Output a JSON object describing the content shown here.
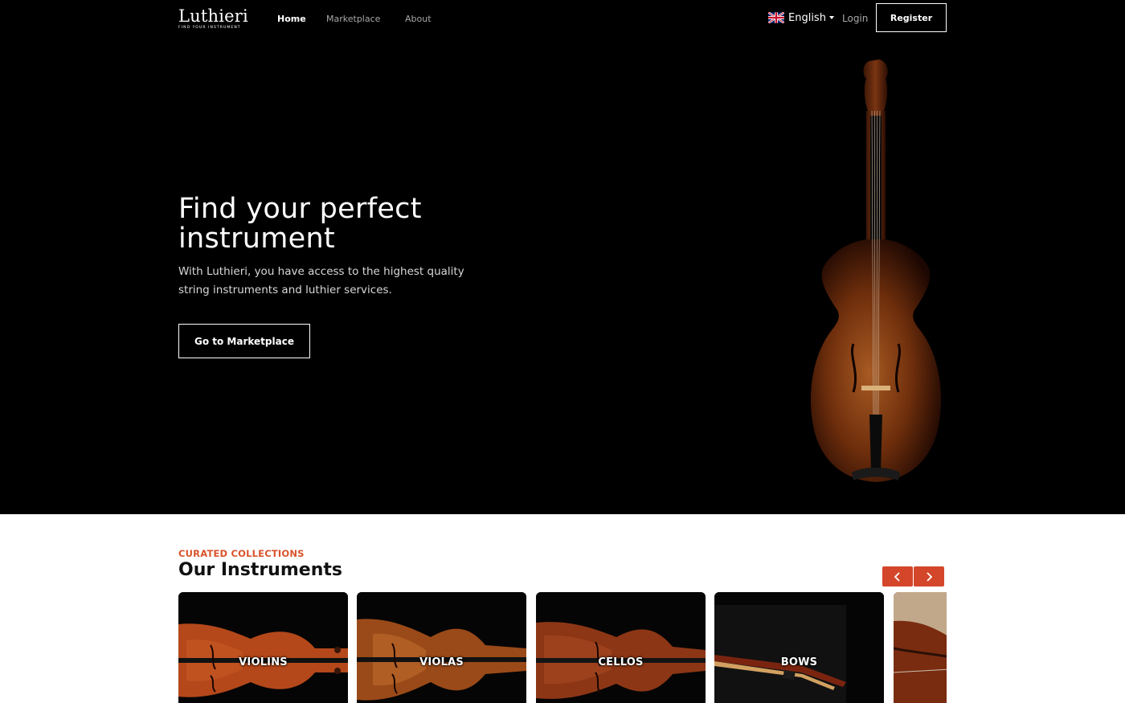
{
  "header": {
    "logo": {
      "wordmark": "Luthieri",
      "tagline": "FIND YOUR INSTRUMENT"
    },
    "nav": [
      {
        "label": "Home",
        "active": true
      },
      {
        "label": "Marketplace",
        "active": false
      },
      {
        "label": "About",
        "active": false
      }
    ],
    "language": {
      "label": "English",
      "flag_icon": "uk-flag-icon"
    },
    "login_label": "Login",
    "register_label": "Register"
  },
  "hero": {
    "title": "Find your perfect instrument",
    "subtitle": "With Luthieri, you have access to the highest quality string instruments and luthier services.",
    "cta_label": "Go to Marketplace"
  },
  "instruments": {
    "eyebrow": "CURATED COLLECTIONS",
    "title": "Our Instruments",
    "prev_icon": "chevron-left-icon",
    "next_icon": "chevron-right-icon",
    "cards": [
      {
        "label": "VIOLINS"
      },
      {
        "label": "VIOLAS"
      },
      {
        "label": "CELLOS"
      },
      {
        "label": "BOWS"
      },
      {
        "label": ""
      }
    ]
  },
  "colors": {
    "hero_bg": "#000000",
    "accent": "#d4462a",
    "eyebrow": "#d9532c",
    "wood": "#8a3a14"
  }
}
